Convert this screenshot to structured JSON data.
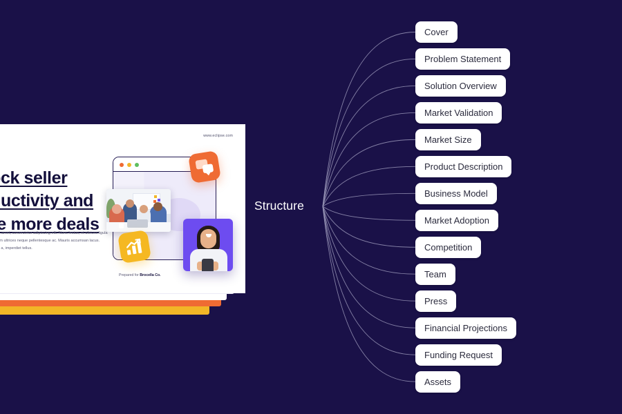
{
  "theme": {
    "background": "#1a1148",
    "node_bg": "#ffffff",
    "node_text": "#2b2b3d",
    "connector": "#9a96b8",
    "accent_orange": "#ef6b33",
    "accent_yellow": "#f5b822",
    "accent_purple": "#6d4cf0",
    "label_text": "#ffffff"
  },
  "center": {
    "label": "Structure"
  },
  "nodes": [
    {
      "label": "Cover"
    },
    {
      "label": "Problem Statement"
    },
    {
      "label": "Solution Overview"
    },
    {
      "label": "Market Validation"
    },
    {
      "label": "Market Size"
    },
    {
      "label": "Product Description"
    },
    {
      "label": "Business Model"
    },
    {
      "label": "Market Adoption"
    },
    {
      "label": "Competition"
    },
    {
      "label": "Team"
    },
    {
      "label": "Press"
    },
    {
      "label": "Financial Projections"
    },
    {
      "label": "Funding Request"
    },
    {
      "label": "Assets"
    }
  ],
  "slide": {
    "url": "www.eclipse.com",
    "headline_line1": "Unlock seller",
    "headline_line2": "productivity and",
    "headline_line3": "close more deals",
    "body": "Lorem ipsum dolor sit amet, consectetur adipiscing elit. Nunc lectus, et ultrices ligula porttitor ac. Vestibulum ultrices neque pellentesque ac. Mauris accumsan lacus. Aenean quam massa a, imperdiet tellus.",
    "footer_prefix": "Prepared for ",
    "footer_client": "Brocella Co.",
    "icons": {
      "chat": "chat-bubble-icon",
      "chart": "bar-chart-growth-icon",
      "person_card": "person-with-phone-photo",
      "team_photo": "team-meeting-photo"
    }
  }
}
